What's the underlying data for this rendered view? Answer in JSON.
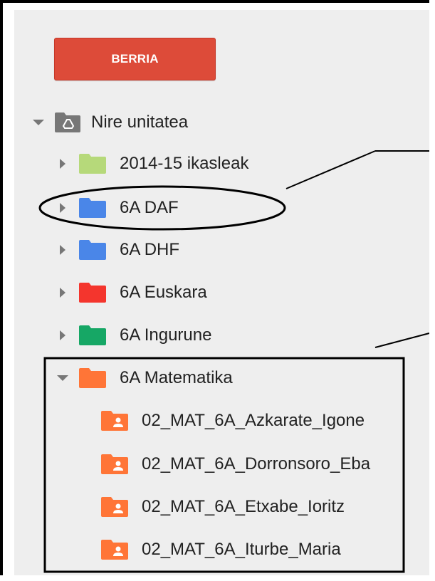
{
  "new_button": {
    "label": "BERRIA"
  },
  "root": {
    "label": "Nire unitatea",
    "icon": "drive-folder-icon",
    "color": "#777777"
  },
  "folders": [
    {
      "label": "2014-15 ikasleak",
      "color": "#b6d97a",
      "expanded": false
    },
    {
      "label": "6A DAF",
      "color": "#4a86e8",
      "expanded": false
    },
    {
      "label": "6A DHF",
      "color": "#4a86e8",
      "expanded": false
    },
    {
      "label": "6A Euskara",
      "color": "#f4352d",
      "expanded": false
    },
    {
      "label": "6A Ingurune",
      "color": "#16a765",
      "expanded": false
    },
    {
      "label": "6A Matematika",
      "color": "#ff7537",
      "expanded": true
    }
  ],
  "subfolders": [
    {
      "label": "02_MAT_6A_Azkarate_Igone",
      "color": "#ff7537",
      "icon": "shared-folder-icon"
    },
    {
      "label": "02_MAT_6A_Dorronsoro_Eba",
      "color": "#ff7537",
      "icon": "shared-folder-icon"
    },
    {
      "label": "02_MAT_6A_Etxabe_Ioritz",
      "color": "#ff7537",
      "icon": "shared-folder-icon"
    },
    {
      "label": "02_MAT_6A_Iturbe_Maria",
      "color": "#ff7537",
      "icon": "shared-folder-icon"
    }
  ],
  "colors": {
    "button": "#dd4b39",
    "panel": "#eeeeee",
    "annotation": "#000000"
  }
}
